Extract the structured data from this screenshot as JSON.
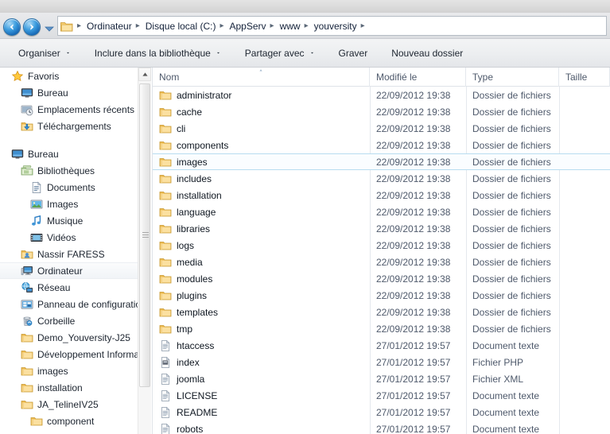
{
  "address": {
    "back_label": "Précédent",
    "forward_label": "Suivant",
    "history_label": "Pages récentes",
    "breadcrumbs": [
      "Ordinateur",
      "Disque local (C:)",
      "AppServ",
      "www",
      "youversity"
    ],
    "separator": "▸"
  },
  "toolbar": {
    "items": [
      {
        "label": "Organiser",
        "has_caret": true
      },
      {
        "label": "Inclure dans la bibliothèque",
        "has_caret": true
      },
      {
        "label": "Partager avec",
        "has_caret": true
      },
      {
        "label": "Graver",
        "has_caret": false
      },
      {
        "label": "Nouveau dossier",
        "has_caret": false
      }
    ]
  },
  "sidebar": {
    "groups": [
      {
        "header": {
          "label": "Favoris",
          "icon": "star-icon",
          "indent": 14
        },
        "items": [
          {
            "label": "Bureau",
            "icon": "desktop-icon",
            "indent": 26
          },
          {
            "label": "Emplacements récents",
            "icon": "recent-places-icon",
            "indent": 26
          },
          {
            "label": "Téléchargements",
            "icon": "downloads-icon",
            "indent": 26
          }
        ]
      },
      {
        "header": {
          "label": "Bureau",
          "icon": "desktop-icon",
          "indent": 14
        },
        "items": [
          {
            "label": "Bibliothèques",
            "icon": "libraries-icon",
            "indent": 26
          },
          {
            "label": "Documents",
            "icon": "document-icon",
            "indent": 38
          },
          {
            "label": "Images",
            "icon": "pictures-icon",
            "indent": 38
          },
          {
            "label": "Musique",
            "icon": "music-icon",
            "indent": 38
          },
          {
            "label": "Vidéos",
            "icon": "video-icon",
            "indent": 38
          },
          {
            "label": "Nassir FARESS",
            "icon": "user-folder-icon",
            "indent": 26
          },
          {
            "label": "Ordinateur",
            "icon": "computer-icon",
            "indent": 26,
            "selected": true
          },
          {
            "label": "Réseau",
            "icon": "network-icon",
            "indent": 26
          },
          {
            "label": "Panneau de configuration",
            "icon": "control-panel-icon",
            "indent": 26
          },
          {
            "label": "Corbeille",
            "icon": "recycle-bin-icon",
            "indent": 26
          },
          {
            "label": "Demo_Youversity-J25",
            "icon": "folder-icon",
            "indent": 26
          },
          {
            "label": "Développement Informatique",
            "icon": "folder-icon",
            "indent": 26
          },
          {
            "label": "images",
            "icon": "folder-icon",
            "indent": 26
          },
          {
            "label": "installation",
            "icon": "folder-icon",
            "indent": 26
          },
          {
            "label": "JA_TelineIV25",
            "icon": "folder-icon",
            "indent": 26
          },
          {
            "label": "component",
            "icon": "folder-icon",
            "indent": 38
          }
        ]
      }
    ]
  },
  "filelist": {
    "columns": [
      {
        "key": "name",
        "label": "Nom",
        "sorted": true
      },
      {
        "key": "date",
        "label": "Modifié le",
        "sorted": false
      },
      {
        "key": "type",
        "label": "Type",
        "sorted": false
      },
      {
        "key": "size",
        "label": "Taille",
        "sorted": false
      }
    ],
    "rows": [
      {
        "name": "administrator",
        "date": "22/09/2012 19:38",
        "type": "Dossier de fichiers",
        "size": "",
        "icon": "folder-icon"
      },
      {
        "name": "cache",
        "date": "22/09/2012 19:38",
        "type": "Dossier de fichiers",
        "size": "",
        "icon": "folder-icon"
      },
      {
        "name": "cli",
        "date": "22/09/2012 19:38",
        "type": "Dossier de fichiers",
        "size": "",
        "icon": "folder-icon"
      },
      {
        "name": "components",
        "date": "22/09/2012 19:38",
        "type": "Dossier de fichiers",
        "size": "",
        "icon": "folder-icon"
      },
      {
        "name": "images",
        "date": "22/09/2012 19:38",
        "type": "Dossier de fichiers",
        "size": "",
        "icon": "folder-icon",
        "selected": true
      },
      {
        "name": "includes",
        "date": "22/09/2012 19:38",
        "type": "Dossier de fichiers",
        "size": "",
        "icon": "folder-icon"
      },
      {
        "name": "installation",
        "date": "22/09/2012 19:38",
        "type": "Dossier de fichiers",
        "size": "",
        "icon": "folder-icon"
      },
      {
        "name": "language",
        "date": "22/09/2012 19:38",
        "type": "Dossier de fichiers",
        "size": "",
        "icon": "folder-icon"
      },
      {
        "name": "libraries",
        "date": "22/09/2012 19:38",
        "type": "Dossier de fichiers",
        "size": "",
        "icon": "folder-icon"
      },
      {
        "name": "logs",
        "date": "22/09/2012 19:38",
        "type": "Dossier de fichiers",
        "size": "",
        "icon": "folder-icon"
      },
      {
        "name": "media",
        "date": "22/09/2012 19:38",
        "type": "Dossier de fichiers",
        "size": "",
        "icon": "folder-icon"
      },
      {
        "name": "modules",
        "date": "22/09/2012 19:38",
        "type": "Dossier de fichiers",
        "size": "",
        "icon": "folder-icon"
      },
      {
        "name": "plugins",
        "date": "22/09/2012 19:38",
        "type": "Dossier de fichiers",
        "size": "",
        "icon": "folder-icon"
      },
      {
        "name": "templates",
        "date": "22/09/2012 19:38",
        "type": "Dossier de fichiers",
        "size": "",
        "icon": "folder-icon"
      },
      {
        "name": "tmp",
        "date": "22/09/2012 19:38",
        "type": "Dossier de fichiers",
        "size": "",
        "icon": "folder-icon"
      },
      {
        "name": "htaccess",
        "date": "27/01/2012 19:57",
        "type": "Document texte",
        "size": "",
        "icon": "text-file-icon"
      },
      {
        "name": "index",
        "date": "27/01/2012 19:57",
        "type": "Fichier PHP",
        "size": "",
        "icon": "php-file-icon"
      },
      {
        "name": "joomla",
        "date": "27/01/2012 19:57",
        "type": "Fichier XML",
        "size": "",
        "icon": "text-file-icon"
      },
      {
        "name": "LICENSE",
        "date": "27/01/2012 19:57",
        "type": "Document texte",
        "size": "",
        "icon": "text-file-icon"
      },
      {
        "name": "README",
        "date": "27/01/2012 19:57",
        "type": "Document texte",
        "size": "",
        "icon": "text-file-icon"
      },
      {
        "name": "robots",
        "date": "27/01/2012 19:57",
        "type": "Document texte",
        "size": "",
        "icon": "text-file-icon"
      }
    ]
  },
  "colors": {
    "folder": "#f9d578",
    "selection_border": "#b8dcf0",
    "accent": "#1667b5"
  }
}
